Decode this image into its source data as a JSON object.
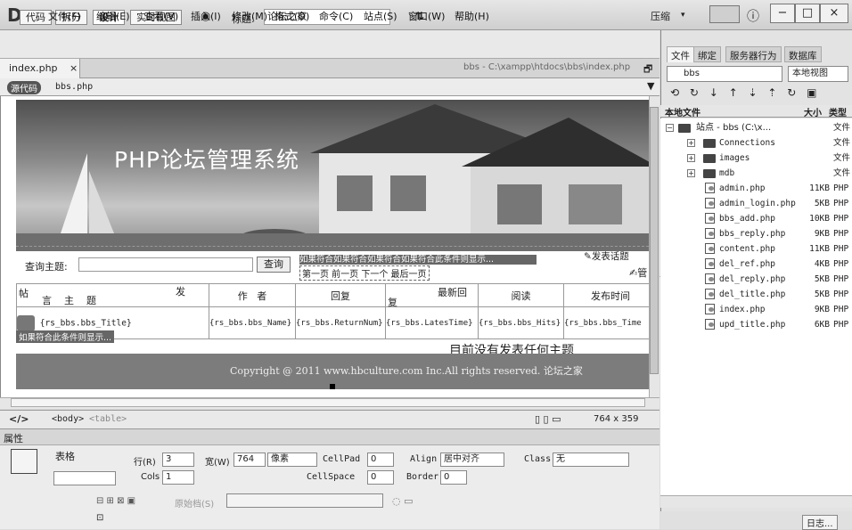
{
  "app": {
    "logo": "Dw",
    "right_label": "压缩",
    "help_icon": "ⓘ"
  },
  "menu": [
    "文件(F)",
    "编辑(E)",
    "查看(V)",
    "插入(I)",
    "修改(M)",
    "格式(O)",
    "命令(C)",
    "站点(S)",
    "窗口(W)",
    "帮助(H)"
  ],
  "toolbar": {
    "code": "代码",
    "split": "拆分",
    "design": "设计",
    "live": "实时视图",
    "title_label": "标题:",
    "title_value": "论坛之家"
  },
  "tab": {
    "filename": "index.php",
    "close": "×",
    "path": "bbs - C:\\xampp\\htdocs\\bbs\\index.php"
  },
  "source": {
    "badge": "源代码",
    "file": "bbs.php"
  },
  "page": {
    "banner_title": "PHP论坛管理系统",
    "search_label": "查询主题:",
    "search_button": "查询",
    "conditional_text": "如果符合如果符合如果符合如果符合此条件则显示...",
    "nav_links": "第一页 前一页 下一个 最后一页",
    "post_topic": "发表话题",
    "manage": "管 理",
    "headers": [
      "言    主    题",
      "作   者",
      "回复",
      "最新回",
      "阅读",
      "发布时间"
    ],
    "headers_prefix": "帖",
    "header_fa": "发",
    "header_fu": "复",
    "row": [
      "{rs_bbs.bbs_Title}",
      "{rs_bbs.bbs_Name}",
      "{rs_bbs.ReturnNum}",
      "{rs_bbs.LatesTime}",
      "{rs_bbs.bbs_Hits}",
      "{rs_bbs.bbs_Time"
    ],
    "row_cond": "如果符合此条件则显示...",
    "empty_msg": "目前没有发表任何主题",
    "copyright": "Copyright @ 2011 www.hbculture.com Inc.All rights reserved. 论坛之家"
  },
  "tagbar": {
    "tags": [
      "<body>",
      "<table>"
    ],
    "size": "764 x 359"
  },
  "properties": {
    "title": "属性",
    "table_label": "表格",
    "rows_label": "行(R)",
    "rows_value": "3",
    "width_label": "宽(W)",
    "width_value": "764",
    "width_unit": "像素",
    "cols_label": "Cols",
    "cols_value": "1",
    "cellpad_label": "CellPad",
    "cellpad_value": "0",
    "cellspace_label": "CellSpace",
    "cellspace_value": "0",
    "align_label": "Align",
    "align_value": "居中对齐",
    "border_label": "Border",
    "border_value": "0",
    "class_label": "Class",
    "class_value": "无",
    "original_label": "原始档(S)"
  },
  "files_panel": {
    "tabs": [
      "文件",
      "绑定",
      "服务器行为",
      "数据库"
    ],
    "site_select": "bbs",
    "view_select": "本地视图",
    "col_local": "本地文件",
    "col_size": "大小",
    "col_type": "类型",
    "root": "站点 - bbs (C:\\x...",
    "root_type": "文件",
    "items": [
      {
        "name": "Connections",
        "size": "",
        "type": "文件",
        "kind": "folder"
      },
      {
        "name": "images",
        "size": "",
        "type": "文件",
        "kind": "folder"
      },
      {
        "name": "mdb",
        "size": "",
        "type": "文件",
        "kind": "folder"
      },
      {
        "name": "admin.php",
        "size": "11KB",
        "type": "PHP",
        "kind": "file"
      },
      {
        "name": "admin_login.php",
        "size": "5KB",
        "type": "PHP",
        "kind": "file"
      },
      {
        "name": "bbs_add.php",
        "size": "10KB",
        "type": "PHP",
        "kind": "file"
      },
      {
        "name": "bbs_reply.php",
        "size": "9KB",
        "type": "PHP",
        "kind": "file"
      },
      {
        "name": "content.php",
        "size": "11KB",
        "type": "PHP",
        "kind": "file"
      },
      {
        "name": "del_ref.php",
        "size": "4KB",
        "type": "PHP",
        "kind": "file"
      },
      {
        "name": "del_reply.php",
        "size": "5KB",
        "type": "PHP",
        "kind": "file"
      },
      {
        "name": "del_title.php",
        "size": "5KB",
        "type": "PHP",
        "kind": "file"
      },
      {
        "name": "index.php",
        "size": "9KB",
        "type": "PHP",
        "kind": "file"
      },
      {
        "name": "upd_title.php",
        "size": "6KB",
        "type": "PHP",
        "kind": "file"
      }
    ],
    "log_button": "日志..."
  }
}
